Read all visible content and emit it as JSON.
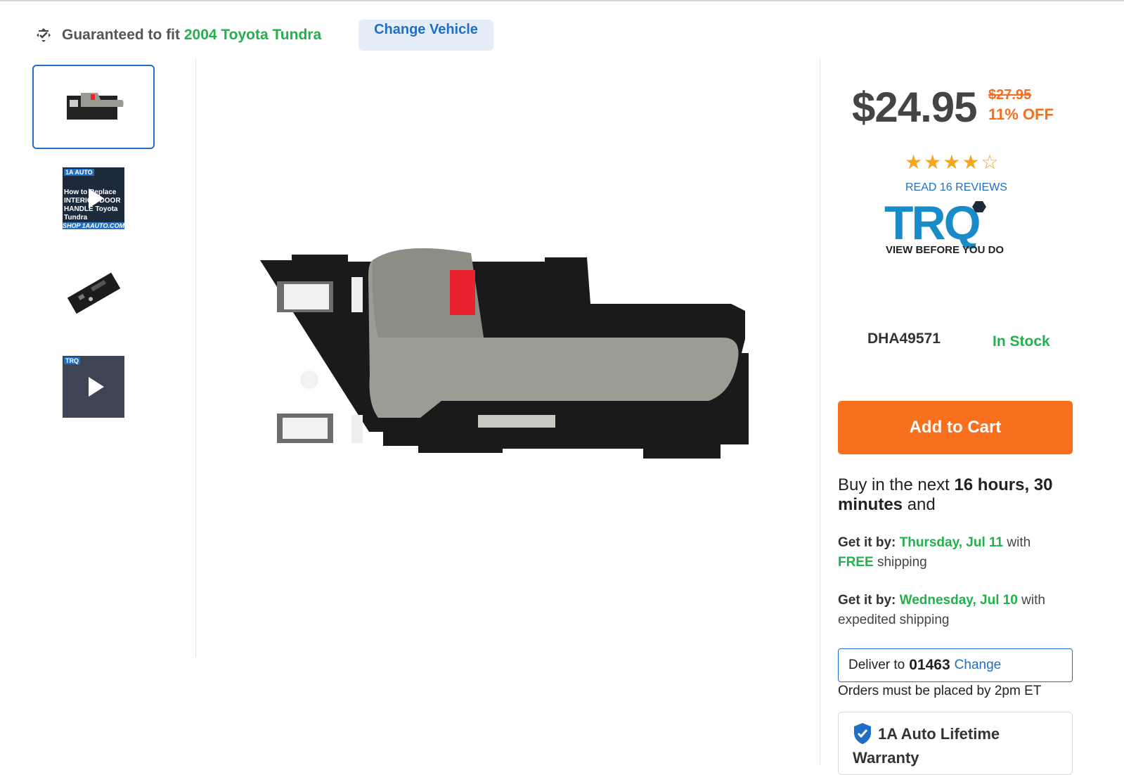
{
  "fitment": {
    "prefix": "Guaranteed to fit",
    "vehicle": "2004 Toyota Tundra",
    "change_button": "Change Vehicle"
  },
  "thumbnails": [
    {
      "type": "image",
      "icon": "door-handle-thumb"
    },
    {
      "type": "video",
      "top": "1A AUTO",
      "mid": "How to Replace INTERIOR DOOR HANDLE Toyota Tundra",
      "bottom": "SHOP 1AAUTO.COM"
    },
    {
      "type": "image",
      "icon": "bracket-thumb"
    },
    {
      "type": "video",
      "top": "TRQ"
    }
  ],
  "product": {
    "price": "$24.95",
    "old_price": "$27.95",
    "discount": "11% OFF",
    "rating": 4.5,
    "reviews_link": "READ 16 REVIEWS",
    "brand_tagline": "VIEW BEFORE YOU DO",
    "sku": "DHA49571",
    "stock": "In Stock",
    "add_to_cart": "Add to Cart"
  },
  "countdown": {
    "prefix": "Buy in the next",
    "time": "16 hours, 30 minutes",
    "suffix": "and"
  },
  "shipping": [
    {
      "label": "Get it by:",
      "date": "Thursday, Jul 11",
      "with": "with",
      "method_highlight": "FREE",
      "method": "shipping"
    },
    {
      "label": "Get it by:",
      "date": "Wednesday, Jul 10",
      "with": "with",
      "method": "expedited shipping"
    }
  ],
  "delivery": {
    "label": "Deliver to",
    "zip": "01463",
    "change": "Change",
    "note": "Orders must be placed by 2pm ET"
  },
  "warranty": {
    "title": "1A Auto Lifetime Warranty"
  },
  "colors": {
    "accent_blue": "#1f6fc5",
    "green": "#22b14c",
    "orange": "#f86f1d"
  }
}
